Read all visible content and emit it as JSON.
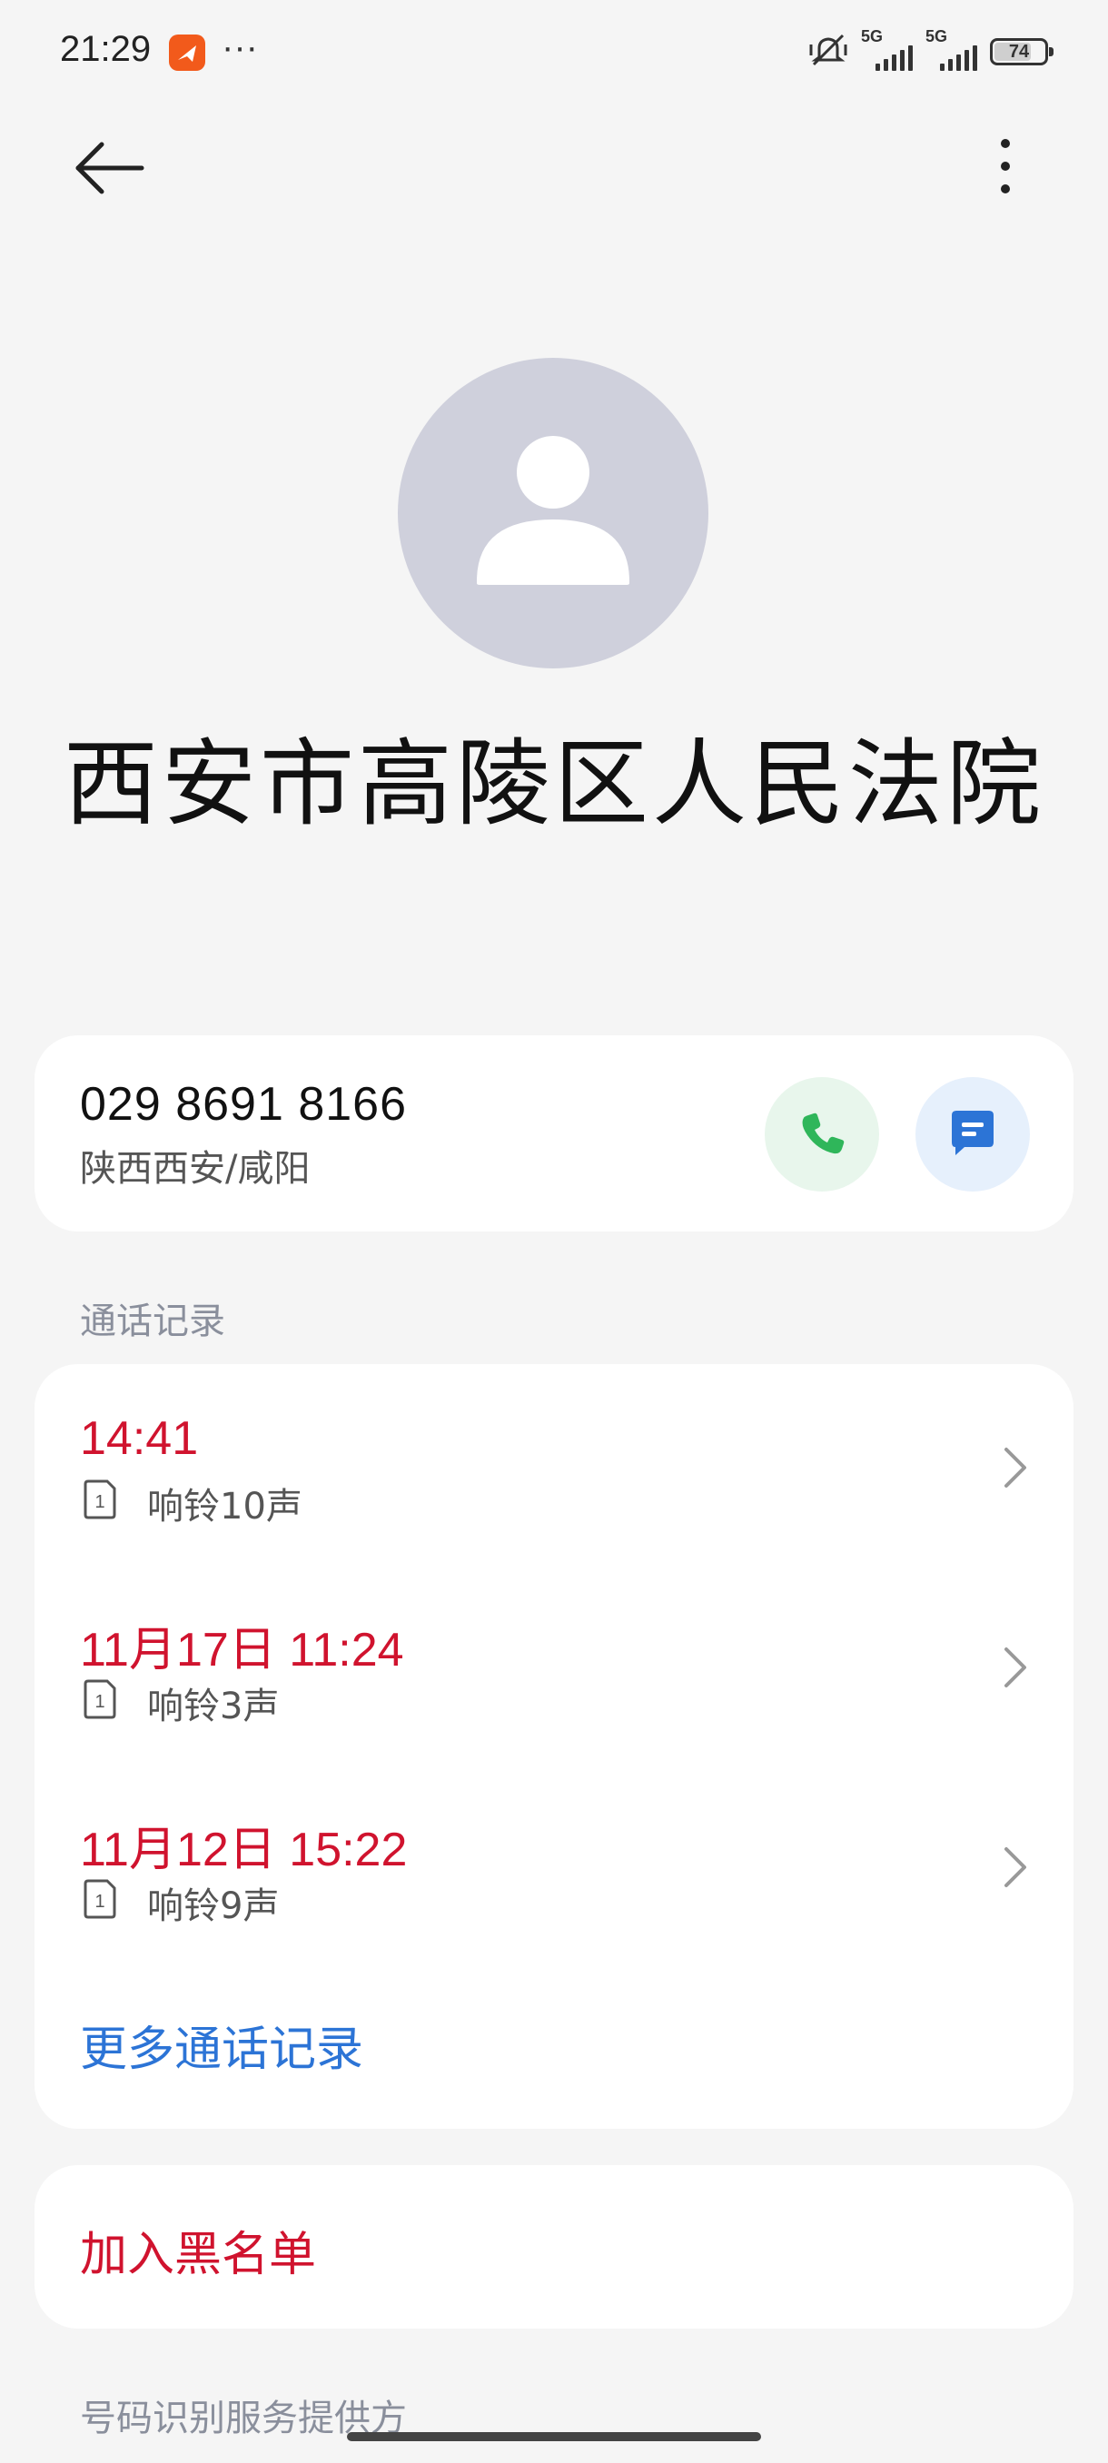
{
  "status_bar": {
    "time": "21:29",
    "more": "···",
    "signal1_label": "5G",
    "signal2_label": "5G",
    "battery": "74",
    "battery_level": 0.74
  },
  "nav": {
    "back_icon": "arrow-left-icon",
    "more_icon": "more-vertical-icon"
  },
  "contact": {
    "avatar_icon": "person-icon",
    "name": "西安市高陵区人民法院",
    "phone_number": "029 8691 8166",
    "location": "陕西西安/咸阳",
    "call_icon": "phone-icon",
    "message_icon": "message-icon"
  },
  "call_history": {
    "title": "通话记录",
    "items": [
      {
        "time": "14:41",
        "desc": "响铃10声",
        "sim": "1"
      },
      {
        "time": "11月17日 11:24",
        "desc": "响铃3声",
        "sim": "1"
      },
      {
        "time": "11月12日 15:22",
        "desc": "响铃9声",
        "sim": "1"
      }
    ],
    "more_label": "更多通话记录"
  },
  "actions": {
    "block_label": "加入黑名单"
  },
  "provider": {
    "title": "号码识别服务提供方"
  },
  "colors": {
    "accent_red": "#d0132e",
    "accent_blue": "#2c74d6",
    "call_green": "#2fb65a",
    "message_blue": "#2c74d6",
    "background": "#f5f5f5"
  }
}
